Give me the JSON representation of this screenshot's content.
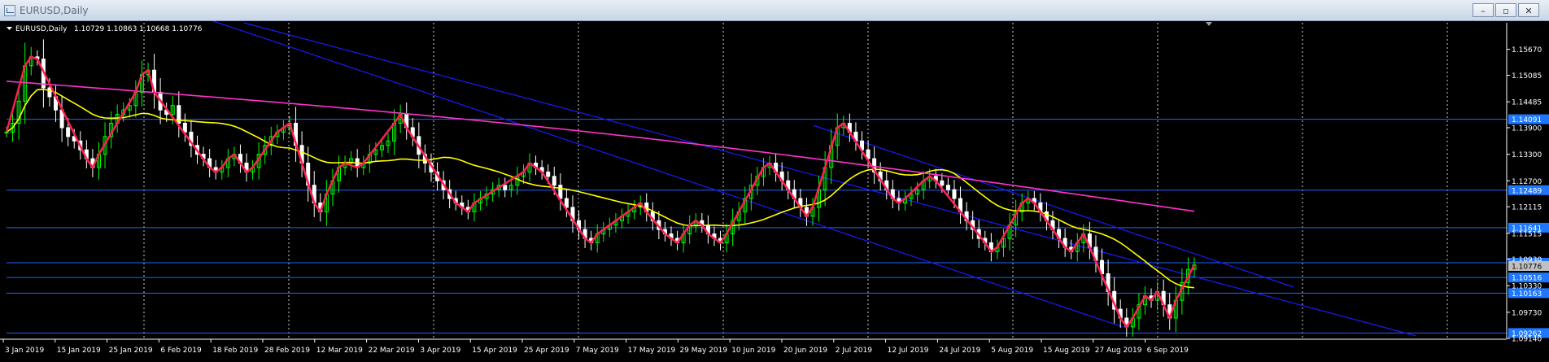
{
  "window": {
    "title": "EURUSD,Daily",
    "minimize": "–",
    "maximize": "▫",
    "close": "✕"
  },
  "header": {
    "symbol": "EURUSD,Daily",
    "ohlc": "1.10729 1.10863 1.10668 1.10776"
  },
  "colors": {
    "background": "#000000",
    "bull": "#00ff00",
    "bear": "#ffffff",
    "ma_fast": "#ffff00",
    "ma_slow": "#ff33cc",
    "zigzag": "#ff2050",
    "hline": "#1e64ff",
    "channel": "#1a1aff",
    "label_bg": "#1e78ff"
  },
  "chart_data": {
    "type": "candlestick",
    "symbol": "EURUSD",
    "timeframe": "Daily",
    "ylim": [
      1.0914,
      1.1627
    ],
    "price_axis_ticks": [
      1.1567,
      1.15085,
      1.14485,
      1.139,
      1.133,
      1.127,
      1.12115,
      1.11515,
      1.1093,
      1.1033,
      1.0973,
      1.0914
    ],
    "price_axis_labels": [
      "1.15670",
      "1.15085",
      "1.14485",
      "1.13900",
      "1.13300",
      "1.12700",
      "1.12115",
      "1.11515",
      "1.10930",
      "1.10330",
      "1.09730",
      "1.09140"
    ],
    "time_labels": [
      "3 Jan 2019",
      "15 Jan 2019",
      "25 Jan 2019",
      "6 Feb 2019",
      "18 Feb 2019",
      "28 Feb 2019",
      "12 Mar 2019",
      "22 Mar 2019",
      "3 Apr 2019",
      "15 Apr 2019",
      "25 Apr 2019",
      "7 May 2019",
      "17 May 2019",
      "29 May 2019",
      "10 Jun 2019",
      "20 Jun 2019",
      "2 Jul 2019",
      "12 Jul 2019",
      "24 Jul 2019",
      "5 Aug 2019",
      "15 Aug 2019",
      "27 Aug 2019",
      "6 Sep 2019"
    ],
    "horizontal_levels": [
      1.14091,
      1.12489,
      1.11641,
      1.10849,
      1.10516,
      1.10163,
      1.09262
    ],
    "level_labels": [
      "1.14091",
      "1.12489",
      "1.11641",
      "1.10849",
      "1.10516",
      "1.10163",
      "1.09262"
    ],
    "current_price": 1.10776,
    "current_price_label": "1.10776",
    "closes": [
      1.138,
      1.14,
      1.145,
      1.153,
      1.155,
      1.1545,
      1.148,
      1.146,
      1.143,
      1.139,
      1.137,
      1.136,
      1.134,
      1.132,
      1.13,
      1.133,
      1.137,
      1.14,
      1.142,
      1.143,
      1.144,
      1.147,
      1.151,
      1.152,
      1.147,
      1.143,
      1.142,
      1.144,
      1.14,
      1.138,
      1.135,
      1.133,
      1.132,
      1.13,
      1.129,
      1.13,
      1.132,
      1.133,
      1.131,
      1.129,
      1.13,
      1.133,
      1.135,
      1.137,
      1.138,
      1.139,
      1.14,
      1.135,
      1.131,
      1.126,
      1.122,
      1.12,
      1.124,
      1.127,
      1.13,
      1.131,
      1.132,
      1.13,
      1.131,
      1.133,
      1.134,
      1.135,
      1.136,
      1.14,
      1.142,
      1.139,
      1.137,
      1.133,
      1.131,
      1.129,
      1.127,
      1.125,
      1.123,
      1.122,
      1.121,
      1.12,
      1.122,
      1.123,
      1.124,
      1.125,
      1.126,
      1.125,
      1.126,
      1.128,
      1.129,
      1.131,
      1.13,
      1.129,
      1.128,
      1.126,
      1.123,
      1.121,
      1.118,
      1.116,
      1.114,
      1.113,
      1.115,
      1.116,
      1.117,
      1.118,
      1.119,
      1.12,
      1.121,
      1.122,
      1.12,
      1.118,
      1.116,
      1.115,
      1.114,
      1.113,
      1.115,
      1.117,
      1.118,
      1.117,
      1.115,
      1.114,
      1.113,
      1.115,
      1.118,
      1.12,
      1.123,
      1.126,
      1.128,
      1.13,
      1.131,
      1.129,
      1.127,
      1.125,
      1.123,
      1.121,
      1.119,
      1.121,
      1.125,
      1.13,
      1.135,
      1.139,
      1.14,
      1.138,
      1.136,
      1.134,
      1.132,
      1.129,
      1.127,
      1.125,
      1.123,
      1.122,
      1.123,
      1.124,
      1.125,
      1.127,
      1.128,
      1.127,
      1.126,
      1.125,
      1.123,
      1.12,
      1.118,
      1.116,
      1.114,
      1.113,
      1.111,
      1.112,
      1.114,
      1.117,
      1.12,
      1.122,
      1.123,
      1.122,
      1.12,
      1.118,
      1.116,
      1.114,
      1.112,
      1.111,
      1.113,
      1.115,
      1.112,
      1.109,
      1.106,
      1.102,
      1.098,
      1.096,
      1.094,
      1.096,
      1.099,
      1.101,
      1.1,
      1.102,
      1.099,
      1.096,
      1.1,
      1.104,
      1.107,
      1.108
    ]
  }
}
